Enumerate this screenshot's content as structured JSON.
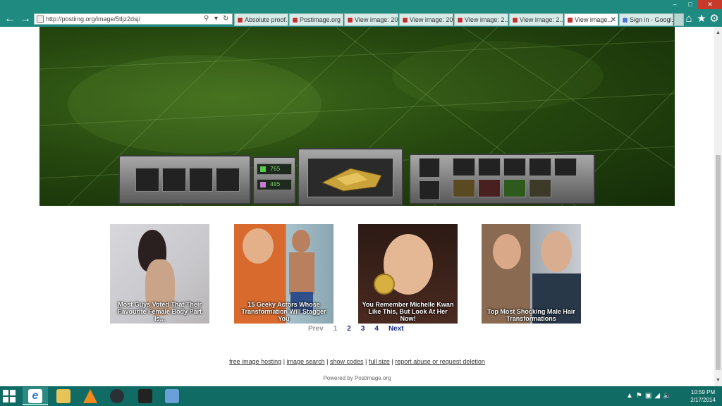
{
  "browser": {
    "url": "http://postimg.org/image/5tljz2dsj/",
    "tabs": [
      {
        "label": "Absolute proof..."
      },
      {
        "label": "Postimage.org ..."
      },
      {
        "label": "View image: 20..."
      },
      {
        "label": "View image: 20..."
      },
      {
        "label": "View image: 2..."
      },
      {
        "label": "View image: 2..."
      },
      {
        "label": "View image..."
      },
      {
        "label": "Sign in - Googl..."
      }
    ],
    "active_tab_index": 6,
    "icons": {
      "back": "back-arrow-icon",
      "forward": "forward-arrow-icon",
      "home": "home-icon",
      "favorites": "star-icon",
      "tools": "gear-icon"
    }
  },
  "game_hud": {
    "counter_1": "765",
    "counter_2": "405"
  },
  "thumbnails": [
    {
      "caption": "Most Guys Voted That Their Favourite Female Body Part Is..."
    },
    {
      "caption": "15 Geeky Actors Whose Transformation Will Stagger You"
    },
    {
      "caption": "You Remember Michelle Kwan Like This, But Look At Her Now!"
    },
    {
      "caption": "Top Most Shocking Male Hair Transformations"
    }
  ],
  "pagination": {
    "prev": "Prev",
    "pages": [
      "1",
      "2",
      "3",
      "4"
    ],
    "current": "1",
    "next": "Next"
  },
  "footer": {
    "links": [
      "free image hosting",
      "image search",
      "show codes",
      "full size",
      "report abuse or request deletion"
    ],
    "separator": "|",
    "powered": "Powered by Postimage.org"
  },
  "taskbar": {
    "time": "10:59 PM",
    "date": "2/17/2014"
  },
  "colors": {
    "chrome": "#1e8a80",
    "taskbar": "#0f6b64",
    "link": "#1a2f8a"
  }
}
